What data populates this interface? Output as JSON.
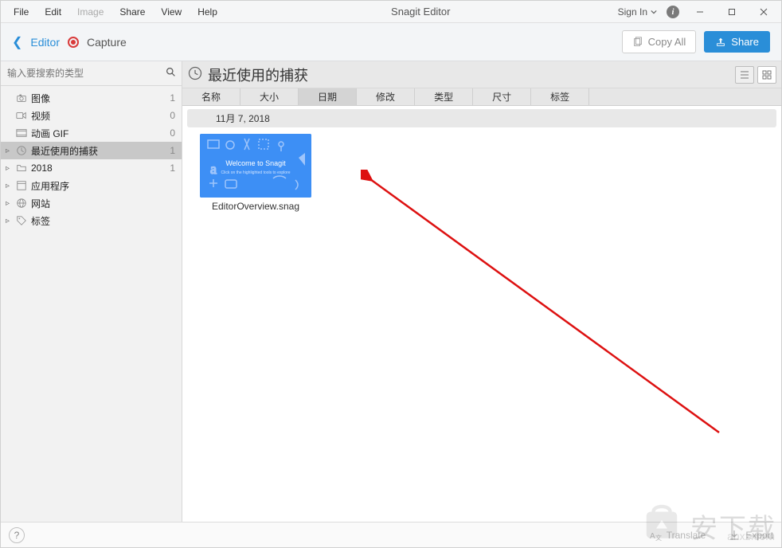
{
  "menubar": {
    "items": [
      "File",
      "Edit",
      "Image",
      "Share",
      "View",
      "Help"
    ],
    "title": "Snagit Editor",
    "signin": "Sign In"
  },
  "toolbar": {
    "editor": "Editor",
    "capture": "Capture",
    "copyall": "Copy All",
    "share": "Share"
  },
  "sidebar": {
    "search_placeholder": "输入要搜索的类型",
    "items": [
      {
        "icon": "camera",
        "label": "图像",
        "count": "1",
        "expandable": false
      },
      {
        "icon": "video",
        "label": "视频",
        "count": "0",
        "expandable": false
      },
      {
        "icon": "gif",
        "label": "动画 GIF",
        "count": "0",
        "expandable": false
      },
      {
        "icon": "clock",
        "label": "最近使用的捕获",
        "count": "1",
        "expandable": true,
        "selected": true
      },
      {
        "icon": "folder",
        "label": "2018",
        "count": "1",
        "expandable": true
      },
      {
        "icon": "app",
        "label": "应用程序",
        "count": "",
        "expandable": true
      },
      {
        "icon": "globe",
        "label": "网站",
        "count": "",
        "expandable": true
      },
      {
        "icon": "tag",
        "label": "标签",
        "count": "",
        "expandable": true
      }
    ]
  },
  "content": {
    "title": "最近使用的捕获",
    "sort_tabs": [
      "名称",
      "大小",
      "日期",
      "修改",
      "类型",
      "尺寸",
      "标签"
    ],
    "sort_active_index": 2,
    "group_date": "11月 7, 2018",
    "thumbs": [
      {
        "label": "EditorOverview.snag",
        "caption": "Welcome to Snagit"
      }
    ]
  },
  "statusbar": {
    "translate": "Translate",
    "export": "Export"
  },
  "watermark": {
    "text": "安下载",
    "domain": "anxz.com"
  }
}
